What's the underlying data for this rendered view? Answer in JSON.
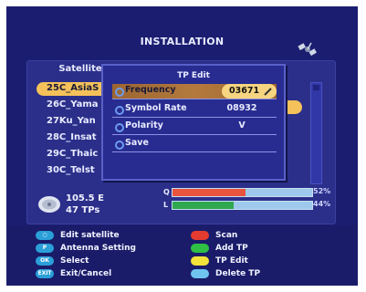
{
  "screen": {
    "title": "INSTALLATION"
  },
  "satellite_list": {
    "header": "Satellite",
    "items": [
      "25C_AsiaS",
      "26C_Yama",
      "27Ku_Yan",
      "28C_Insat",
      "29C_Thaic",
      "30C_Telst"
    ],
    "selected_index": 0
  },
  "tp_edit": {
    "title": "TP Edit",
    "rows": [
      {
        "label": "Frequency",
        "value": "03671"
      },
      {
        "label": "Symbol Rate",
        "value": "08932"
      },
      {
        "label": "Polarity",
        "value": "V"
      },
      {
        "label": "Save",
        "value": ""
      }
    ],
    "selected_index": 0
  },
  "status": {
    "position": "105.5 E",
    "tp_count": "47 TPs",
    "quality": {
      "label": "Q",
      "percent_text": "52%",
      "level": 0.52
    },
    "level": {
      "label": "L",
      "percent_text": "44%",
      "level": 0.44
    }
  },
  "legend": {
    "left": [
      {
        "key": "○",
        "text": "Edit satellite",
        "color": "#2a9fd8"
      },
      {
        "key": "P",
        "text": "Antenna Setting",
        "color": "#2a9fd8"
      },
      {
        "key": "OK",
        "text": "Select",
        "color": "#2a9fd8"
      },
      {
        "key": "EXIT",
        "text": "Exit/Cancel",
        "color": "#2a9fd8"
      }
    ],
    "right": [
      {
        "text": "Scan",
        "color": "#e33b2f"
      },
      {
        "text": "Add TP",
        "color": "#2fbf45"
      },
      {
        "text": "TP Edit",
        "color": "#f2e23a"
      },
      {
        "text": "Delete TP",
        "color": "#6fc4ef"
      }
    ]
  },
  "colors": {
    "background": "#1b1d70",
    "highlight": "#f4c15a",
    "quality_fill": "#e8553f",
    "level_fill": "#2fa84f"
  }
}
